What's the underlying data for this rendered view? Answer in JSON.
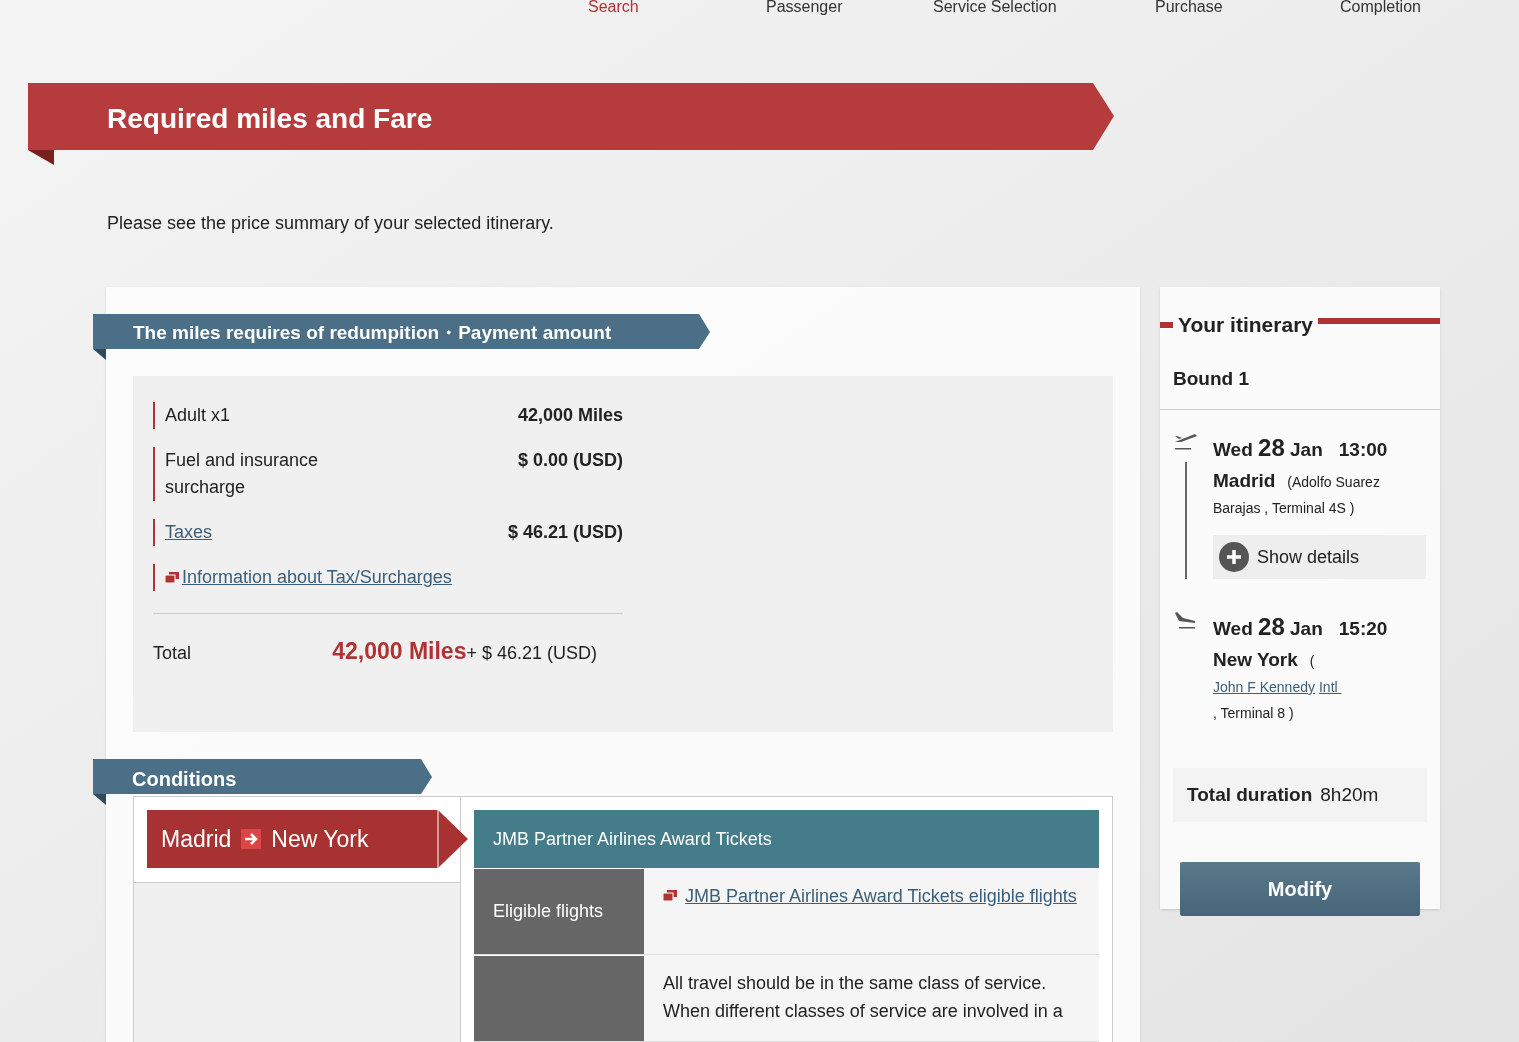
{
  "steps": [
    {
      "label": "Search",
      "selected": true
    },
    {
      "label": "Passenger",
      "selected": false
    },
    {
      "label": "Service Selection",
      "selected": false
    },
    {
      "label": "Purchase",
      "selected": false
    },
    {
      "label": "Completion",
      "selected": false
    }
  ],
  "title": "Required miles and Fare",
  "intro": "Please see the price summary of your selected itinerary.",
  "fare": {
    "heading": "The miles requires of redumpition・Payment amount",
    "rows": [
      {
        "kind": "text",
        "label": "Adult x1",
        "value": "42,000 Miles"
      },
      {
        "kind": "text",
        "label": "Fuel and insurance surcharge",
        "value": "$ 0.00 (USD)"
      },
      {
        "kind": "link",
        "label": "Taxes",
        "value": "$ 46.21 (USD)"
      }
    ],
    "info_link": "Information about Tax/Surcharges",
    "total": {
      "label": "Total",
      "miles": "42,000 Miles",
      "plus": "+",
      "amount": "$ 46.21 (USD)"
    }
  },
  "conditions": {
    "heading": "Conditions",
    "route": {
      "from": "Madrid",
      "to": "New York"
    },
    "fare_type": "JMB Partner Airlines Award Tickets",
    "rows": [
      {
        "label": "Eligible flights",
        "kind": "link",
        "text": "JMB Partner Airlines Award Tickets eligible flights"
      },
      {
        "kind": "text",
        "text": "All travel should be in the same class of service. When different classes of service are involved in a"
      }
    ]
  },
  "itinerary": {
    "title": "Your itinerary",
    "bound": "Bound 1",
    "segments": [
      {
        "kind": "departure",
        "day": "Wed",
        "date": "28",
        "month": "Jan",
        "time": "13:00",
        "city": "Madrid",
        "location_parts": [
          {
            "text": "(Adolfo Suarez",
            "link": false
          },
          {
            "text": "Barajas , Terminal 4S )",
            "link": false
          }
        ],
        "show_details": "Show details"
      },
      {
        "kind": "arrival",
        "day": "Wed",
        "date": "28",
        "month": "Jan",
        "time": "15:20",
        "city": "New York",
        "location_parts": [
          {
            "text": "( ",
            "link": false
          },
          {
            "text": "John F Kennedy",
            "link": true
          },
          {
            "text": "Intl ",
            "link": true
          },
          {
            "text": ", Terminal 8 )",
            "link": false
          }
        ]
      }
    ],
    "duration_label": "Total duration",
    "duration": "8h20m",
    "modify": "Modify"
  }
}
